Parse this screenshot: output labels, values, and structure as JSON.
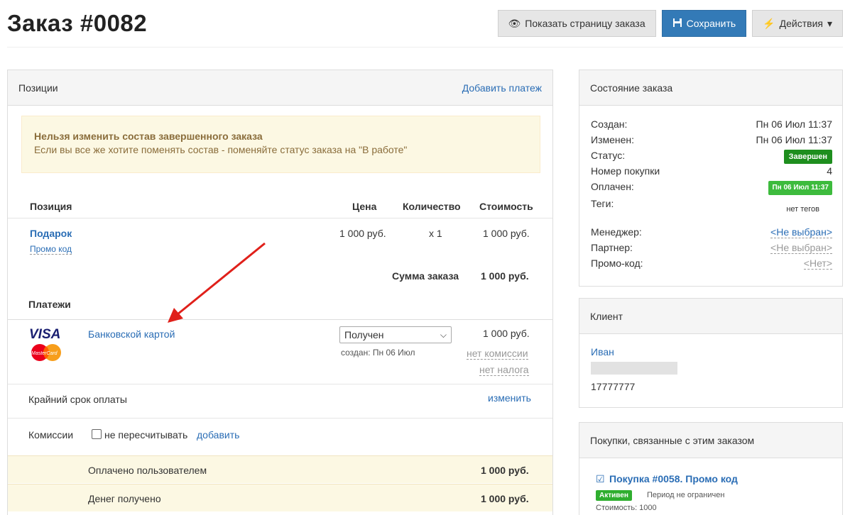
{
  "header": {
    "title": "Заказ #0082",
    "show_page_label": "Показать страницу заказа",
    "save_label": "Сохранить",
    "actions_label": "Действия"
  },
  "positions": {
    "title": "Позиции",
    "add_payment": "Добавить платеж",
    "alert_title": "Нельзя изменить состав завершенного заказа",
    "alert_text": "Если вы все же хотите поменять состав - поменяйте статус заказа на \"В работе\"",
    "columns": {
      "position": "Позиция",
      "price": "Цена",
      "quantity": "Количество",
      "cost": "Стоимость"
    },
    "item": {
      "name": "Подарок",
      "promo": "Промо код",
      "price": "1 000 руб.",
      "quantity": "x 1",
      "cost": "1 000 руб."
    },
    "sum_label": "Сумма заказа",
    "sum_value": "1 000 руб.",
    "payments_title": "Платежи",
    "payment": {
      "card_visa": "VISA",
      "card_mc": "MasterCard",
      "method": "Банковской картой",
      "status": "Получен",
      "created": "создан: Пн 06 Июл",
      "amount": "1 000 руб.",
      "no_commission": "нет комиссии",
      "no_tax": "нет налога"
    },
    "deadline_label": "Крайний срок оплаты",
    "deadline_change": "изменить",
    "commissions_label": "Комиссии",
    "no_recalc": "не пересчитывать",
    "add": "добавить",
    "paid_by_user_label": "Оплачено пользователем",
    "paid_by_user_value": "1 000 руб.",
    "money_received_label": "Денег получено",
    "money_received_value": "1 000 руб."
  },
  "state": {
    "title": "Состояние заказа",
    "created_label": "Создан:",
    "created_value": "Пн 06 Июл 11:37",
    "changed_label": "Изменен:",
    "changed_value": "Пн 06 Июл 11:37",
    "status_label": "Статус:",
    "status_value": "Завершен",
    "purchase_no_label": "Номер покупки",
    "purchase_no_value": "4",
    "paid_label": "Оплачен:",
    "paid_value": "Пн 06 Июл 11:37",
    "tags_label": "Теги:",
    "tags_value": "нет тегов",
    "manager_label": "Менеджер:",
    "manager_value": "<Не выбран>",
    "partner_label": "Партнер:",
    "partner_value": "<Не выбран>",
    "promo_label": "Промо-код:",
    "promo_value": "<Нет>"
  },
  "client": {
    "title": "Клиент",
    "name": "Иван",
    "phone": "17777777"
  },
  "purchases": {
    "title": "Покупки, связанные с этим заказом",
    "link": "Покупка #0058. Промо код",
    "badge": "Активен",
    "period": "Период не ограничен",
    "cost": "Стоимость: 1000"
  },
  "colors": {
    "primary": "#337ab7",
    "link": "#2a6db5",
    "alert_bg": "#fcf8e3",
    "badge_green": "#1e8e1e",
    "arrow": "#e0201a"
  }
}
